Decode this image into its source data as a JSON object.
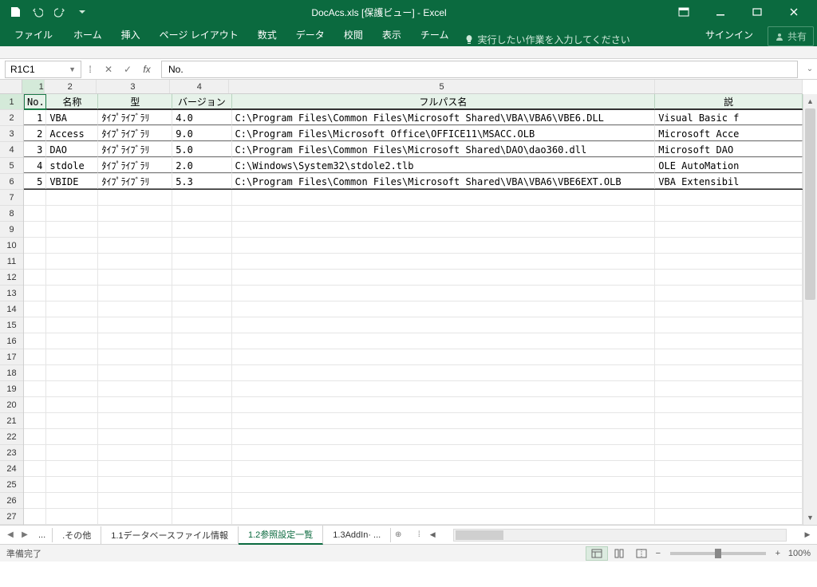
{
  "title": "DocAcs.xls  [保護ビュー] - Excel",
  "ribbon": {
    "file": "ファイル",
    "tabs": [
      "ホーム",
      "挿入",
      "ページ レイアウト",
      "数式",
      "データ",
      "校閲",
      "表示",
      "チーム"
    ],
    "tell": "実行したい作業を入力してください",
    "signin": "サインイン",
    "share": "共有"
  },
  "name_box": "R1C1",
  "formula": "No.",
  "col_headers": [
    "1",
    "2",
    "3",
    "4",
    "5"
  ],
  "sheet_header": [
    "No.",
    "名称",
    "型",
    "バージョン",
    "フルパス名",
    "説"
  ],
  "rows": [
    {
      "no": "1",
      "name": "VBA",
      "type": "ﾀｲﾌﾟﾗｲﾌﾞﾗﾘ",
      "ver": "4.0",
      "path": "C:\\Program Files\\Common Files\\Microsoft Shared\\VBA\\VBA6\\VBE6.DLL",
      "desc": "Visual Basic f"
    },
    {
      "no": "2",
      "name": "Access",
      "type": "ﾀｲﾌﾟﾗｲﾌﾞﾗﾘ",
      "ver": "9.0",
      "path": "C:\\Program Files\\Microsoft Office\\OFFICE11\\MSACC.OLB",
      "desc": "Microsoft Acce"
    },
    {
      "no": "3",
      "name": "DAO",
      "type": "ﾀｲﾌﾟﾗｲﾌﾞﾗﾘ",
      "ver": "5.0",
      "path": "C:\\Program Files\\Common Files\\Microsoft Shared\\DAO\\dao360.dll",
      "desc": "Microsoft DAO "
    },
    {
      "no": "4",
      "name": "stdole",
      "type": "ﾀｲﾌﾟﾗｲﾌﾞﾗﾘ",
      "ver": "2.0",
      "path": "C:\\Windows\\System32\\stdole2.tlb",
      "desc": "OLE AutoMation"
    },
    {
      "no": "5",
      "name": "VBIDE",
      "type": "ﾀｲﾌﾟﾗｲﾌﾞﾗﾘ",
      "ver": "5.3",
      "path": "C:\\Program Files\\Common Files\\Microsoft Shared\\VBA\\VBA6\\VBE6EXT.OLB",
      "desc": "VBA Extensibil"
    }
  ],
  "tabs": {
    "dots": "...",
    "t1": ".その他",
    "t2": "1.1データベースファイル情報",
    "t3": "1.2参照設定一覧",
    "t4": "1.3AddIn· ..."
  },
  "status": {
    "ready": "準備完了",
    "zoom": "100%"
  },
  "colors": {
    "brand": "#0b6a3f"
  }
}
